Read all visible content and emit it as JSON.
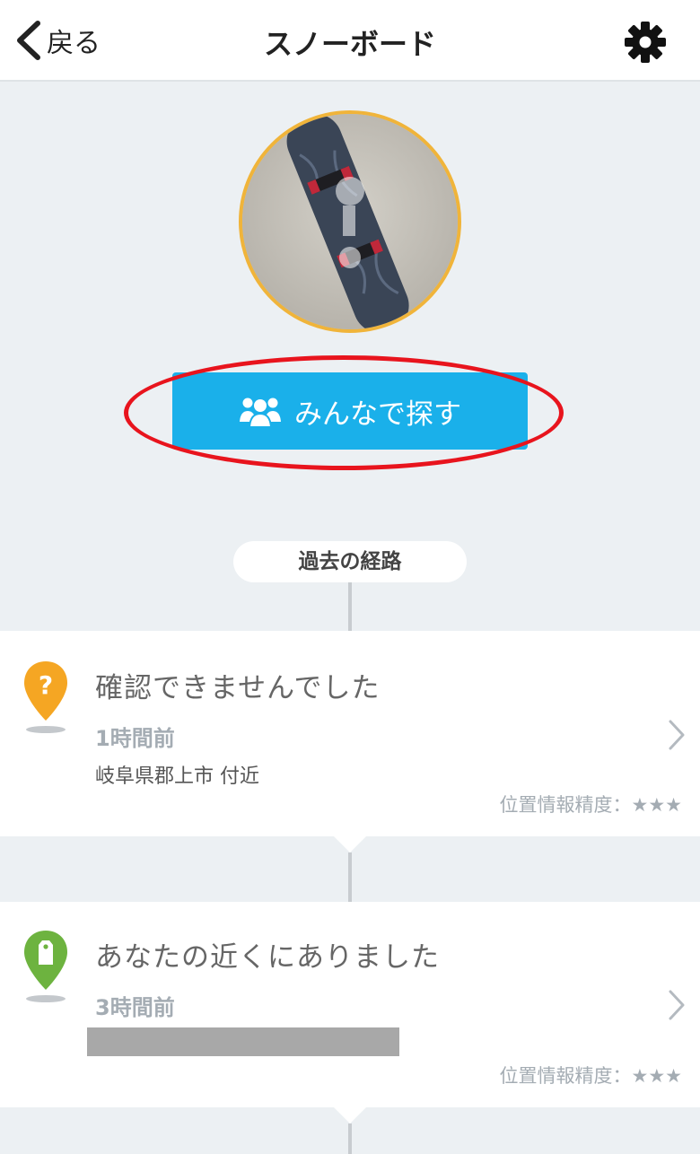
{
  "navbar": {
    "back_label": "戻る",
    "title": "スノーボード"
  },
  "actions": {
    "search_together": "みんなで探す"
  },
  "history": {
    "label": "過去の経路",
    "entries": [
      {
        "status": "確認できませんでした",
        "time_ago": "1時間前",
        "location": "岐阜県郡上市 付近",
        "accuracy": "位置情報精度：★★★",
        "pin_icon": "question-pin-icon",
        "pin_color": "#f5a623"
      },
      {
        "status": "あなたの近くにありました",
        "time_ago": "3時間前",
        "location": "",
        "accuracy": "位置情報精度：★★★",
        "pin_icon": "tag-pin-icon",
        "pin_color": "#6db33f"
      }
    ]
  },
  "colors": {
    "accent": "#1ab0ea",
    "highlight_ring": "#e8141d",
    "photo_border": "#f0b43a"
  }
}
